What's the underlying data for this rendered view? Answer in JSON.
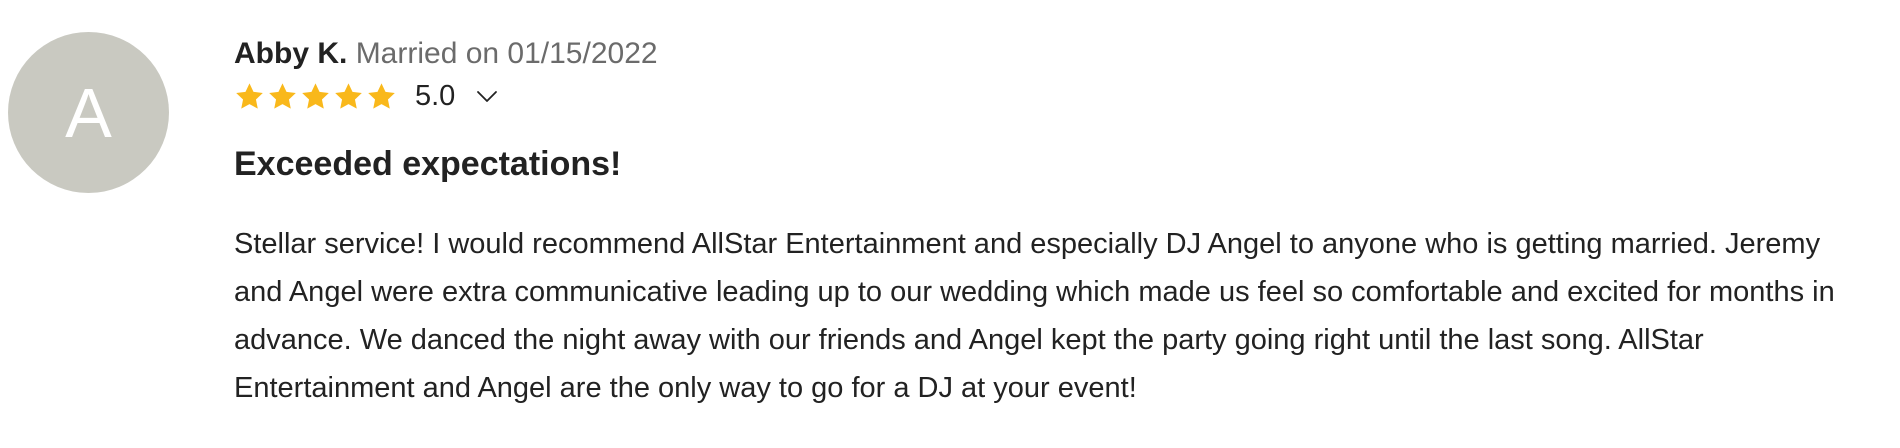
{
  "reviewer": {
    "initial": "A",
    "name": "Abby K.",
    "married_on": "Married on 01/15/2022"
  },
  "rating": {
    "stars": 5,
    "value": "5.0",
    "star_color": "#f9b81b",
    "icon": "star-icon",
    "expand_icon": "chevron-down-icon"
  },
  "review": {
    "title": "Exceeded expectations!",
    "body": "Stellar service! I would recommend AllStar Entertainment and especially DJ Angel to anyone who is getting married. Jeremy and Angel were extra communicative leading up to our wedding which made us feel so comfortable and excited for months in advance. We danced the night away with our friends and Angel kept the party going right until the last song. AllStar Entertainment and Angel are the only way to go for a DJ at your event!"
  },
  "colors": {
    "avatar_bg": "#c9c9c1",
    "text": "#222222",
    "muted_text": "#6b6b6b"
  }
}
